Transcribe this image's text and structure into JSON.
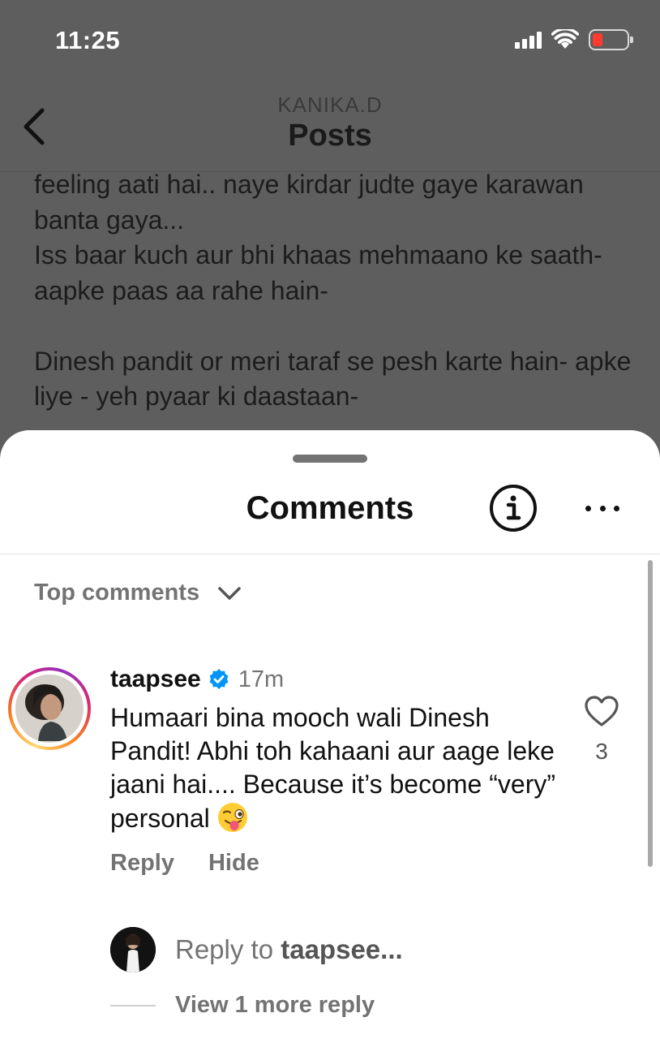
{
  "status": {
    "time": "11:25"
  },
  "nav": {
    "subtitle": "KANIKA.D",
    "title": "Posts",
    "back_icon": "chevron-left-icon"
  },
  "post": {
    "paragraphs": [
      "feeling aati hai.. naye kirdar judte gaye karawan banta gaya...\nIss baar kuch aur bhi khaas mehmaano ke saath- aapke paas aa rahe hain-",
      "Dinesh pandit or meri taraf se pesh karte hain- apke liye - yeh  pyaar ki daastaan-"
    ]
  },
  "sheet": {
    "title": "Comments",
    "info_icon": "info-icon",
    "more_icon": "more-horizontal-icon",
    "sort_label": "Top comments",
    "sort_icon": "chevron-down-icon"
  },
  "comment": {
    "username": "taapsee",
    "verified": true,
    "time": "17m",
    "text": "Humaari bina mooch wali Dinesh Pandit! Abhi toh kahaani aur aage leke jaani hai.... Because it’s become “very” personal",
    "emoji": "winking-face-with-tongue",
    "likes": "3",
    "reply_label": "Reply",
    "hide_label": "Hide"
  },
  "reply_box": {
    "prefix": "Reply to ",
    "target": "taapsee..."
  },
  "view_more": {
    "label": "View 1 more reply"
  },
  "colors": {
    "verified": "#0095f6",
    "muted": "#737373",
    "battery_low": "#ff3b30"
  }
}
